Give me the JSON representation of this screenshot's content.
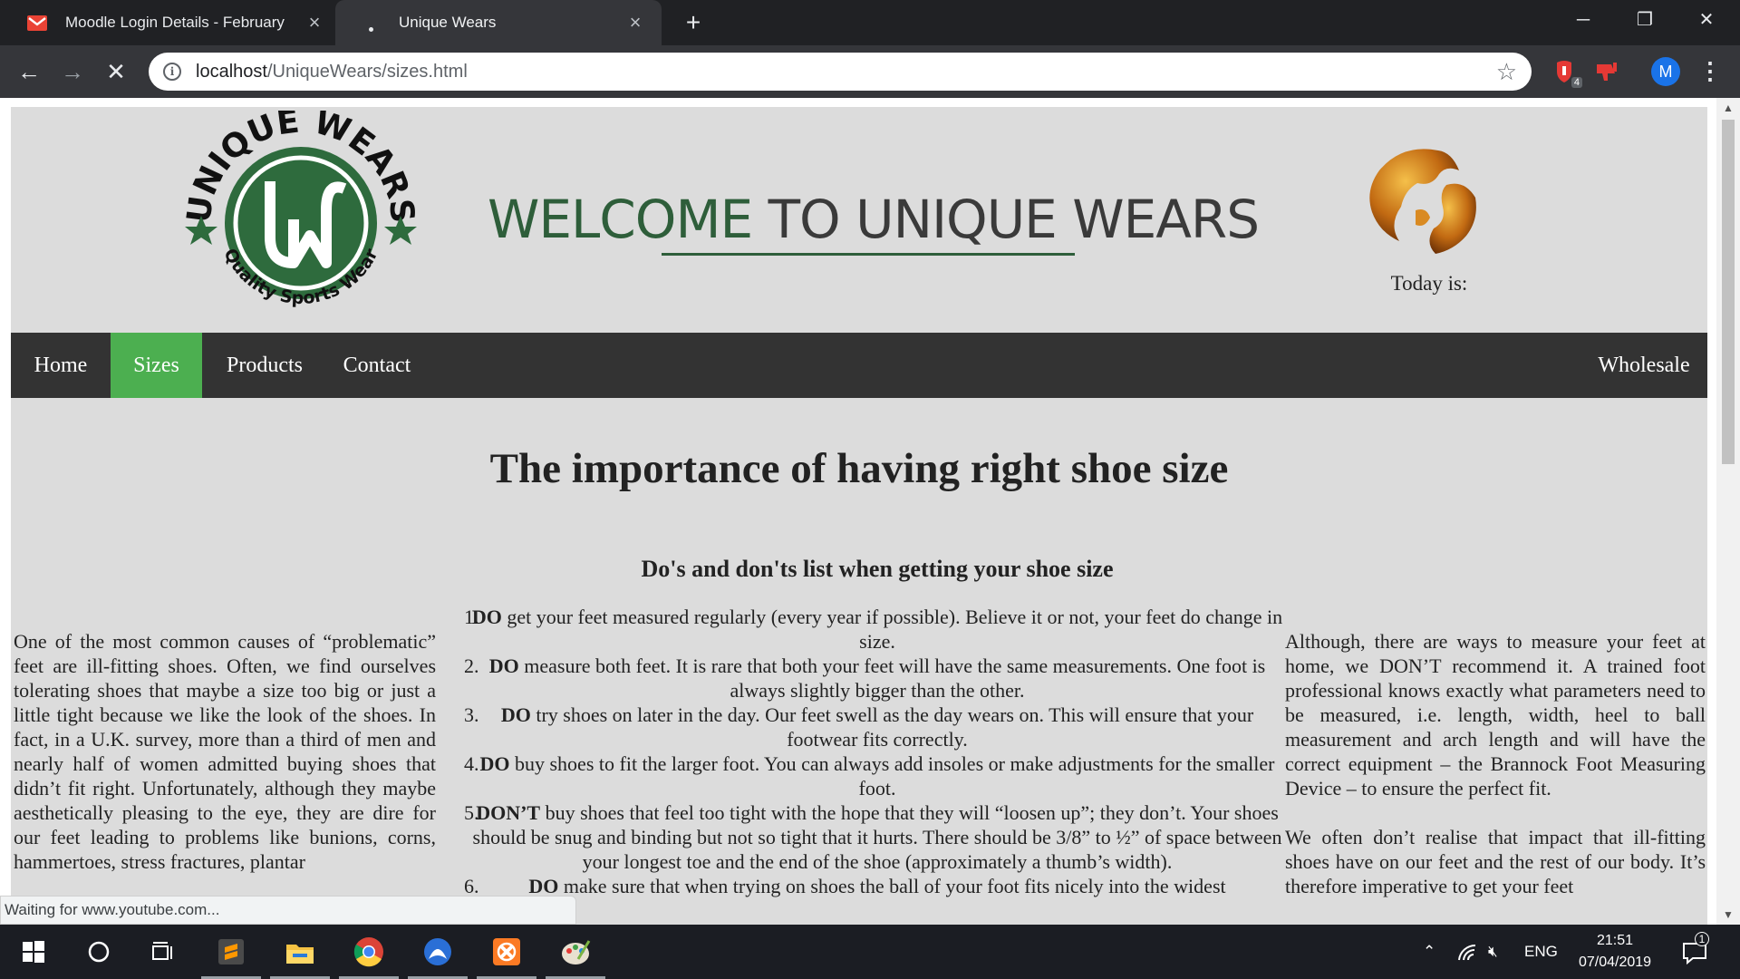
{
  "browser": {
    "tabs": [
      {
        "title": "Moodle Login Details - February",
        "icon": "gmail-icon"
      },
      {
        "title": "Unique Wears",
        "icon": "loading-icon"
      }
    ],
    "new_tab": "+",
    "window_controls": {
      "minimize": "─",
      "restore": "❐",
      "close": "✕"
    },
    "url_host": "localhost",
    "url_path": "/UniqueWears/sizes.html",
    "extension_badge": "4",
    "profile_initial": "M",
    "status_text": "Waiting for www.youtube.com..."
  },
  "header": {
    "logo_text_top": "UNIQUE WEARS",
    "logo_monogram": "UW",
    "logo_text_bottom": "Quality Sports Wear",
    "welcome_part1": "WELCOME",
    "welcome_part2": "TO UNIQUE WEARS",
    "today_label": "Today is:"
  },
  "nav": {
    "items": [
      "Home",
      "Sizes",
      "Products",
      "Contact"
    ],
    "active": "Sizes",
    "right_item": "Wholesale",
    "active_color": "#4caf50"
  },
  "content": {
    "title": "The importance of having right shoe size",
    "left_paragraph": "One of the most common causes of “problematic” feet are ill-fitting shoes. Often, we find ourselves tolerating shoes that maybe a size too big or just a little tight because we like the look of the shoes. In fact, in a U.K. survey, more than a third of men and nearly half of women admitted buying shoes that didn’t fit right. Unfortunately, although they maybe aesthetically pleasing to the eye, they are dire for our feet leading to problems like bunions, corns, hammertoes, stress fractures, plantar",
    "list_title": "Do's and don'ts list when getting your shoe size",
    "list": [
      {
        "num": "1.",
        "lead": "DO",
        "text": "get your feet measured regularly (every year if possible). Believe it or not, your feet do change in size."
      },
      {
        "num": "2.",
        "lead": "DO",
        "text": "measure both feet. It is rare that both your feet will have the same measurements. One foot is always slightly bigger than the other."
      },
      {
        "num": "3.",
        "lead": "DO",
        "text": "try shoes on later in the day. Our feet swell as the day wears on. This will ensure that your footwear fits correctly."
      },
      {
        "num": "4.",
        "lead": "DO",
        "text": "buy shoes to fit the larger foot. You can always add insoles or make adjustments for the smaller foot."
      },
      {
        "num": "5.",
        "lead": "DON’T",
        "text": "buy shoes that feel too tight with the hope that they will “loosen up”; they don’t. Your shoes should be snug and binding but not so tight that it hurts. There should be 3/8” to ½” of space between your longest toe and the end of the shoe (approximately a thumb’s width)."
      },
      {
        "num": "6.",
        "lead": "DO",
        "text": "make sure that when trying on shoes the ball of your foot fits nicely into the widest"
      }
    ],
    "right_paragraph_1": "Although, there are ways to measure your feet at home, we DON’T recommend it. A trained foot professional knows exactly what parameters need to be measured, i.e. length, width, heel to ball measurement and arch length and will have the correct equipment – the Brannock Foot Measuring Device – to ensure the perfect fit.",
    "right_paragraph_2": "We often don’t realise that impact that ill-fitting shoes have on our feet and the rest of our body. It’s therefore imperative to get your feet"
  },
  "taskbar": {
    "apps": [
      "windows-start-icon",
      "cortana-icon",
      "task-view-icon",
      "sublime-text-icon",
      "file-explorer-icon",
      "chrome-icon",
      "app-icon",
      "xampp-icon",
      "paint-icon"
    ],
    "language": "ENG",
    "time": "21:51",
    "date": "07/04/2019",
    "notification_count": "1"
  }
}
